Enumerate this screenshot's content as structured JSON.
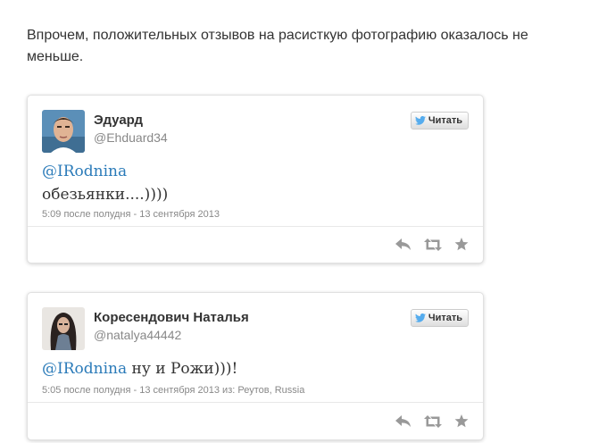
{
  "intro_text": "Впрочем, положительных отзывов на расисткую фотографию оказалось не меньше.",
  "colors": {
    "mention": "#2b7bb9",
    "icon": "#999999",
    "twitter_bird": "#55acee"
  },
  "tweets": [
    {
      "name": "Эдуард",
      "handle": "@Ehduard34",
      "follow_label": "Читать",
      "mention": "@IRodnina",
      "text": "обезьянки....))))",
      "meta": "5:09 после полудня - 13 сентября 2013",
      "actions": [
        "reply-icon",
        "retweet-icon",
        "favorite-icon"
      ]
    },
    {
      "name": "Коресендович Наталья",
      "handle": "@natalya44442",
      "follow_label": "Читать",
      "mention": "@IRodnina",
      "text": " ну и Рожи)))!",
      "meta": "5:05 после полудня - 13 сентября 2013 из: Реутов, Russia",
      "actions": [
        "reply-icon",
        "retweet-icon",
        "favorite-icon"
      ]
    }
  ]
}
